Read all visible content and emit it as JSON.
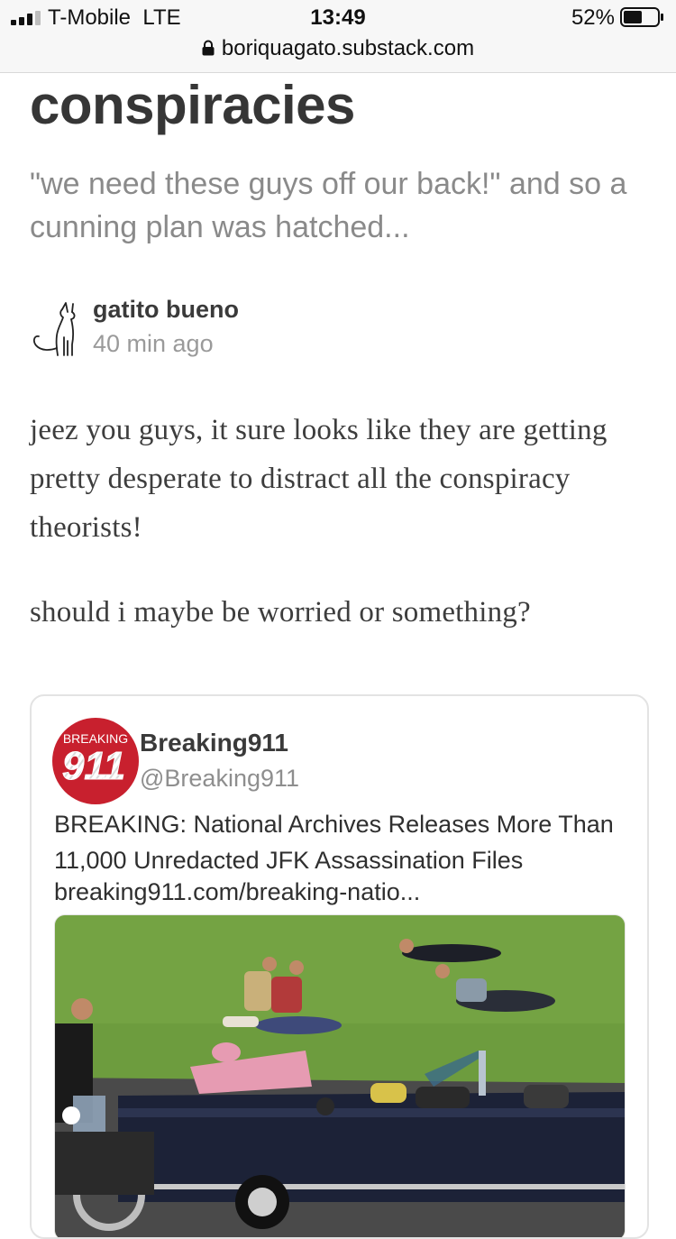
{
  "status_bar": {
    "carrier": "T-Mobile",
    "network": "LTE",
    "time": "13:49",
    "battery_percent": "52%",
    "battery_level": 0.52,
    "signal_bars_filled": 3,
    "signal_bars_total": 4,
    "url": "boriquagato.substack.com"
  },
  "article": {
    "title": "conspiracies",
    "subtitle": "\"we need these guys off our back!\" and so a cunning plan was hatched...",
    "author": "gatito bueno",
    "time_ago": "40 min ago",
    "paragraphs": [
      "jeez you guys, it sure looks like they are getting pretty desperate to distract all the conspiracy theorists!",
      "should i maybe be worried or something?"
    ]
  },
  "tweet": {
    "display_name": "Breaking911",
    "handle": "@Breaking911",
    "avatar_text_top": "BREAKING",
    "avatar_text_main": "911",
    "text": "BREAKING: National Archives Releases More Than 11,000 Unredacted JFK Assassination Files",
    "link": "breaking911.com/breaking-natio..."
  },
  "colors": {
    "avatar_red": "#c8202e",
    "grass": "#6d9c3e",
    "car": "#1c2237"
  }
}
